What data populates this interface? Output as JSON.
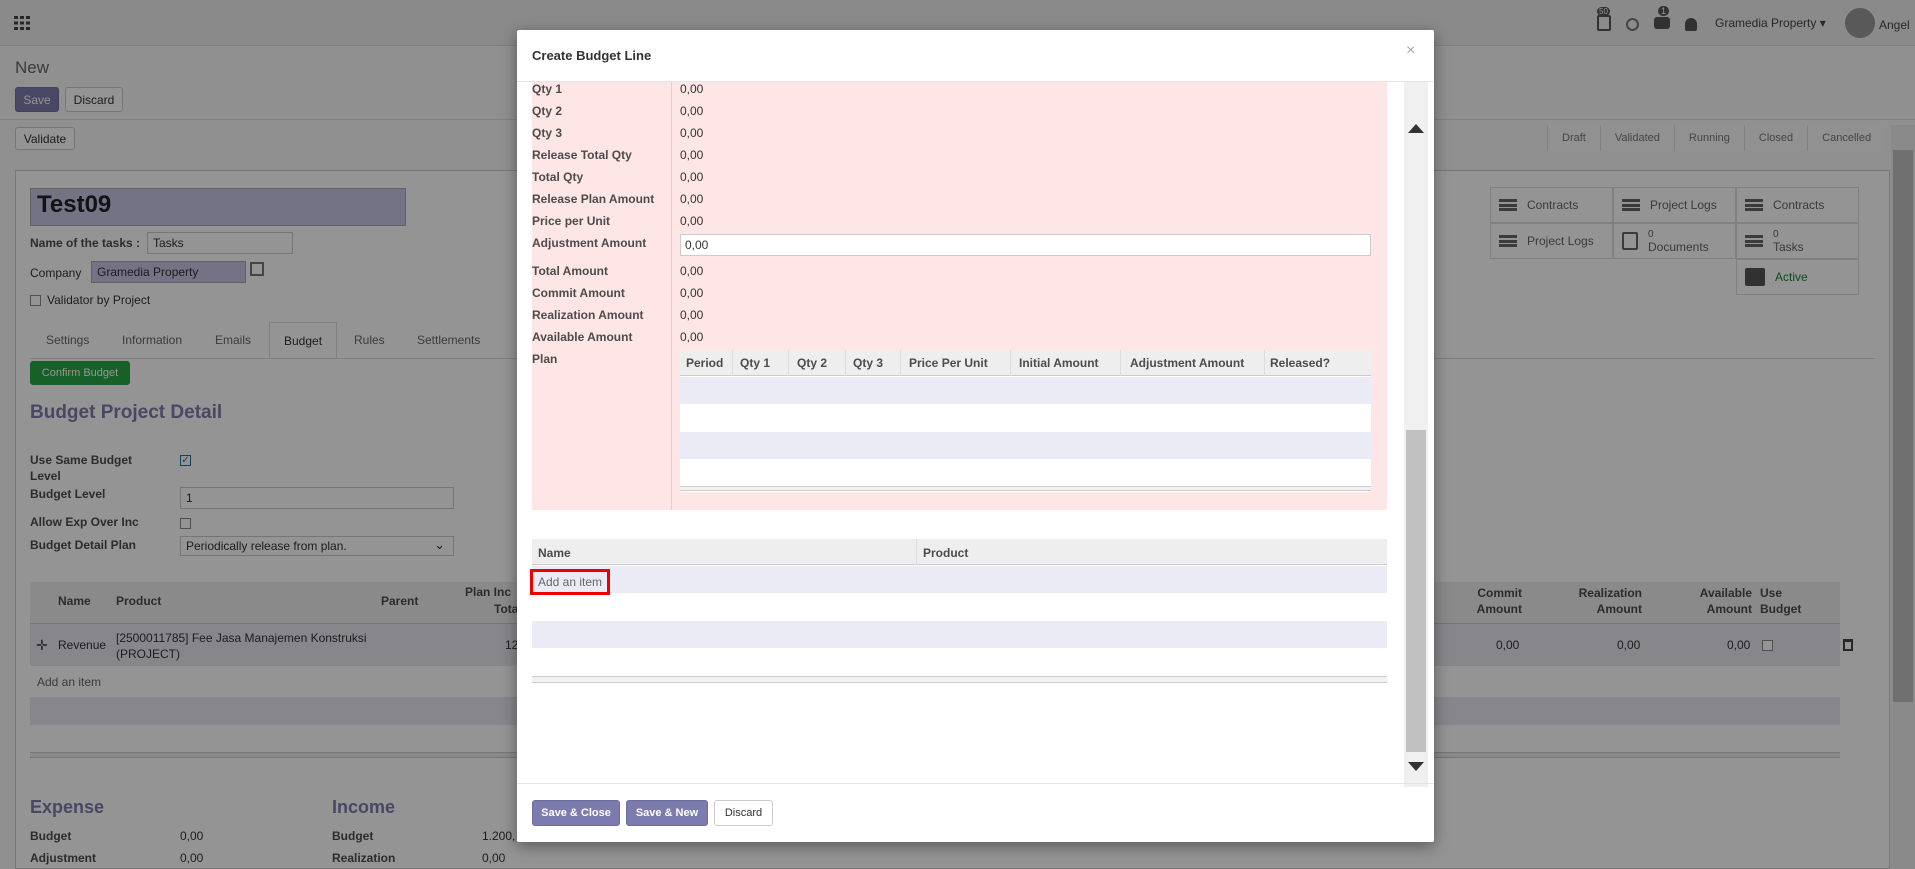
{
  "topbar": {
    "badge_1": "50",
    "badge_2": "1",
    "company": "Gramedia Property",
    "user": "Angel"
  },
  "breadcrumb": {
    "title": "New"
  },
  "actions": {
    "save": "Save",
    "discard": "Discard",
    "validate": "Validate"
  },
  "status_steps": [
    "Draft",
    "Validated",
    "Running",
    "Closed",
    "Cancelled"
  ],
  "form": {
    "name": "Test09",
    "tasks_label": "Name of the tasks :",
    "tasks_value": "Tasks",
    "company_label": "Company",
    "company_value": "Gramedia Property",
    "validator_label": "Validator by Project"
  },
  "smart_buttons": [
    {
      "label": "Contracts",
      "count": ""
    },
    {
      "label": "Project Logs",
      "count": ""
    },
    {
      "label": "Contracts",
      "count": ""
    },
    {
      "label": "Project Logs",
      "count": ""
    },
    {
      "label": "Documents",
      "count": "0"
    },
    {
      "label": "Tasks",
      "count": "0"
    },
    {
      "label": "Active",
      "count": ""
    }
  ],
  "tabs": [
    "Settings",
    "Information",
    "Emails",
    "Budget",
    "Rules",
    "Settlements"
  ],
  "budget": {
    "confirm_button": "Confirm Budget",
    "heading": "Budget Project Detail",
    "use_same_label": "Use Same Budget Level",
    "level_label": "Budget Level",
    "level_value": "1",
    "allow_exp_label": "Allow Exp Over Inc",
    "detail_plan_label": "Budget Detail Plan",
    "detail_plan_value": "Periodically release from plan."
  },
  "bg_table": {
    "headers": [
      "Name",
      "Product",
      "Parent",
      "Plan Inc",
      "Total",
      "Commit Amount",
      "Realization Amount",
      "Available Amount",
      "Use Budget"
    ],
    "row": {
      "name": "Revenue",
      "product": "[2500011785] Fee Jasa Manajemen Konstruksi (PROJECT)",
      "plan_partial": "12",
      "commit": "0,00",
      "realization": "0,00",
      "available": "0,00"
    },
    "add_item": "Add an item"
  },
  "summary": {
    "expense_title": "Expense",
    "income_title": "Income",
    "expense_rows": [
      {
        "label": "Budget",
        "value": "0,00"
      },
      {
        "label": "Adjustment",
        "value": "0,00"
      }
    ],
    "income_rows": [
      {
        "label": "Budget",
        "value": "1.200,"
      },
      {
        "label": "Realization",
        "value": "0,00"
      }
    ]
  },
  "modal": {
    "title": "Create Budget Line",
    "close": "×",
    "fields": [
      {
        "label": "Qty 1",
        "value": "0,00"
      },
      {
        "label": "Qty 2",
        "value": "0,00"
      },
      {
        "label": "Qty 3",
        "value": "0,00"
      },
      {
        "label": "Release Total Qty",
        "value": "0,00"
      },
      {
        "label": "Total Qty",
        "value": "0,00"
      },
      {
        "label": "Release Plan Amount",
        "value": "0,00"
      },
      {
        "label": "Price per Unit",
        "value": "0,00"
      },
      {
        "label": "Adjustment Amount",
        "value": "0,00"
      },
      {
        "label": "Total Amount",
        "value": "0,00"
      },
      {
        "label": "Commit Amount",
        "value": "0,00"
      },
      {
        "label": "Realization Amount",
        "value": "0,00"
      },
      {
        "label": "Available Amount",
        "value": "0,00"
      }
    ],
    "plan_label": "Plan",
    "plan_headers": [
      "Period",
      "Qty 1",
      "Qty 2",
      "Qty 3",
      "Price Per Unit",
      "Initial Amount",
      "Adjustment Amount",
      "Released?"
    ],
    "lines_headers": [
      "Name",
      "Product"
    ],
    "add_item": "Add an item",
    "save_close": "Save & Close",
    "save_new": "Save & New",
    "discard": "Discard"
  }
}
